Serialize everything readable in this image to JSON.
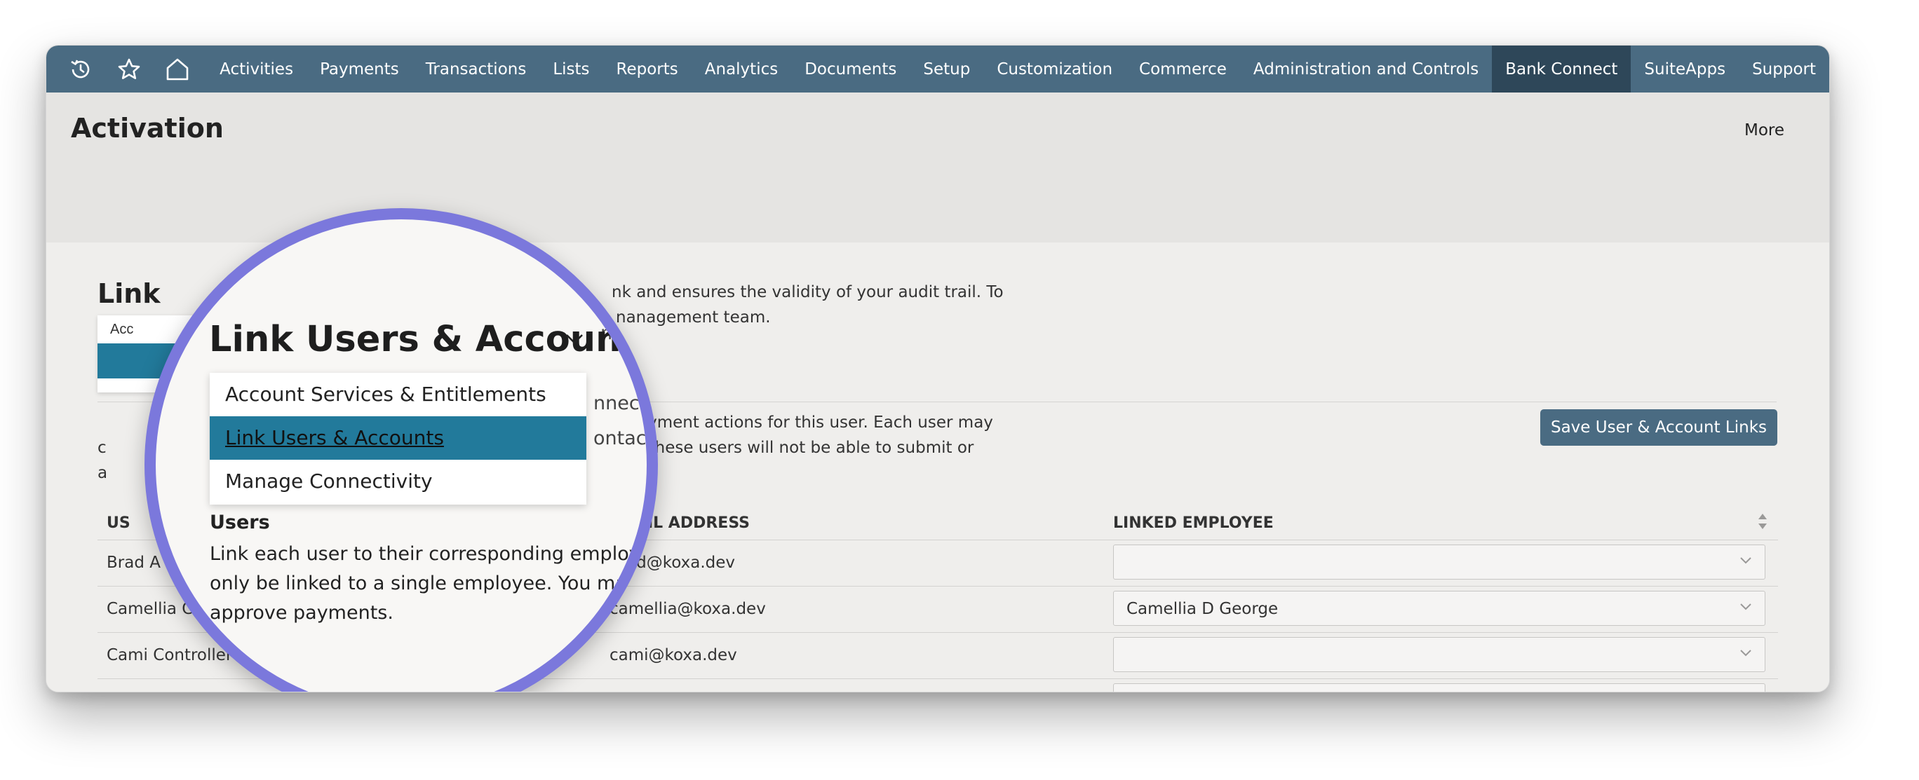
{
  "nav": {
    "icons": [
      "history-icon",
      "star-icon",
      "home-icon"
    ],
    "items": [
      {
        "label": "Activities"
      },
      {
        "label": "Payments"
      },
      {
        "label": "Transactions"
      },
      {
        "label": "Lists"
      },
      {
        "label": "Reports"
      },
      {
        "label": "Analytics"
      },
      {
        "label": "Documents"
      },
      {
        "label": "Setup"
      },
      {
        "label": "Customization"
      },
      {
        "label": "Commerce"
      },
      {
        "label": "Administration and Controls"
      },
      {
        "label": "Bank Connect",
        "active": true
      },
      {
        "label": "SuiteApps"
      },
      {
        "label": "Support"
      }
    ],
    "bar_color": "#4a6b82",
    "active_color": "#2e4759"
  },
  "header": {
    "title": "Activation",
    "more_label": "More"
  },
  "section": {
    "title_visible": "Link",
    "mini_menu_first": "Acc",
    "desc_line1_tail": "nk and ensures the validity of your audit trail. To",
    "desc_line2_tail": "nanagement team.",
    "mid_line1_tail": "nnect",
    "mid_line2_tail": "ontac",
    "users_desc_line1_tail": "ayment actions for this user. Each user may",
    "users_desc_line2_tail": "- these users will not be able to submit or",
    "left_fragment_1": "c",
    "left_fragment_2": "a"
  },
  "save_button": {
    "label": "Save User & Account Links",
    "color": "#4a6b82"
  },
  "table": {
    "headers": {
      "user": "US",
      "email": "EMAIL ADDRESS",
      "linked": "LINKED EMPLOYEE"
    },
    "rows": [
      {
        "user": "Brad A",
        "email": "brad@koxa.dev",
        "employee": ""
      },
      {
        "user": "Camellia Co",
        "email": "camellia@koxa.dev",
        "employee": "Camellia D George"
      },
      {
        "user": "Cami Controller",
        "email": "cami@koxa.dev",
        "employee": ""
      }
    ]
  },
  "magnifier": {
    "border_color": "#7b78dc",
    "title": "Link Users & Accounts",
    "options": [
      {
        "label": "Account Services & Entitlements",
        "selected": false
      },
      {
        "label": "Link Users & Accounts",
        "selected": true
      },
      {
        "label": "Manage Connectivity",
        "selected": false
      }
    ],
    "selected_color": "#227a9b",
    "users_heading": "Users",
    "users_paragraph": [
      "Link each user to their corresponding employee",
      "only be linked to a single employee. You may l",
      "approve payments."
    ]
  }
}
